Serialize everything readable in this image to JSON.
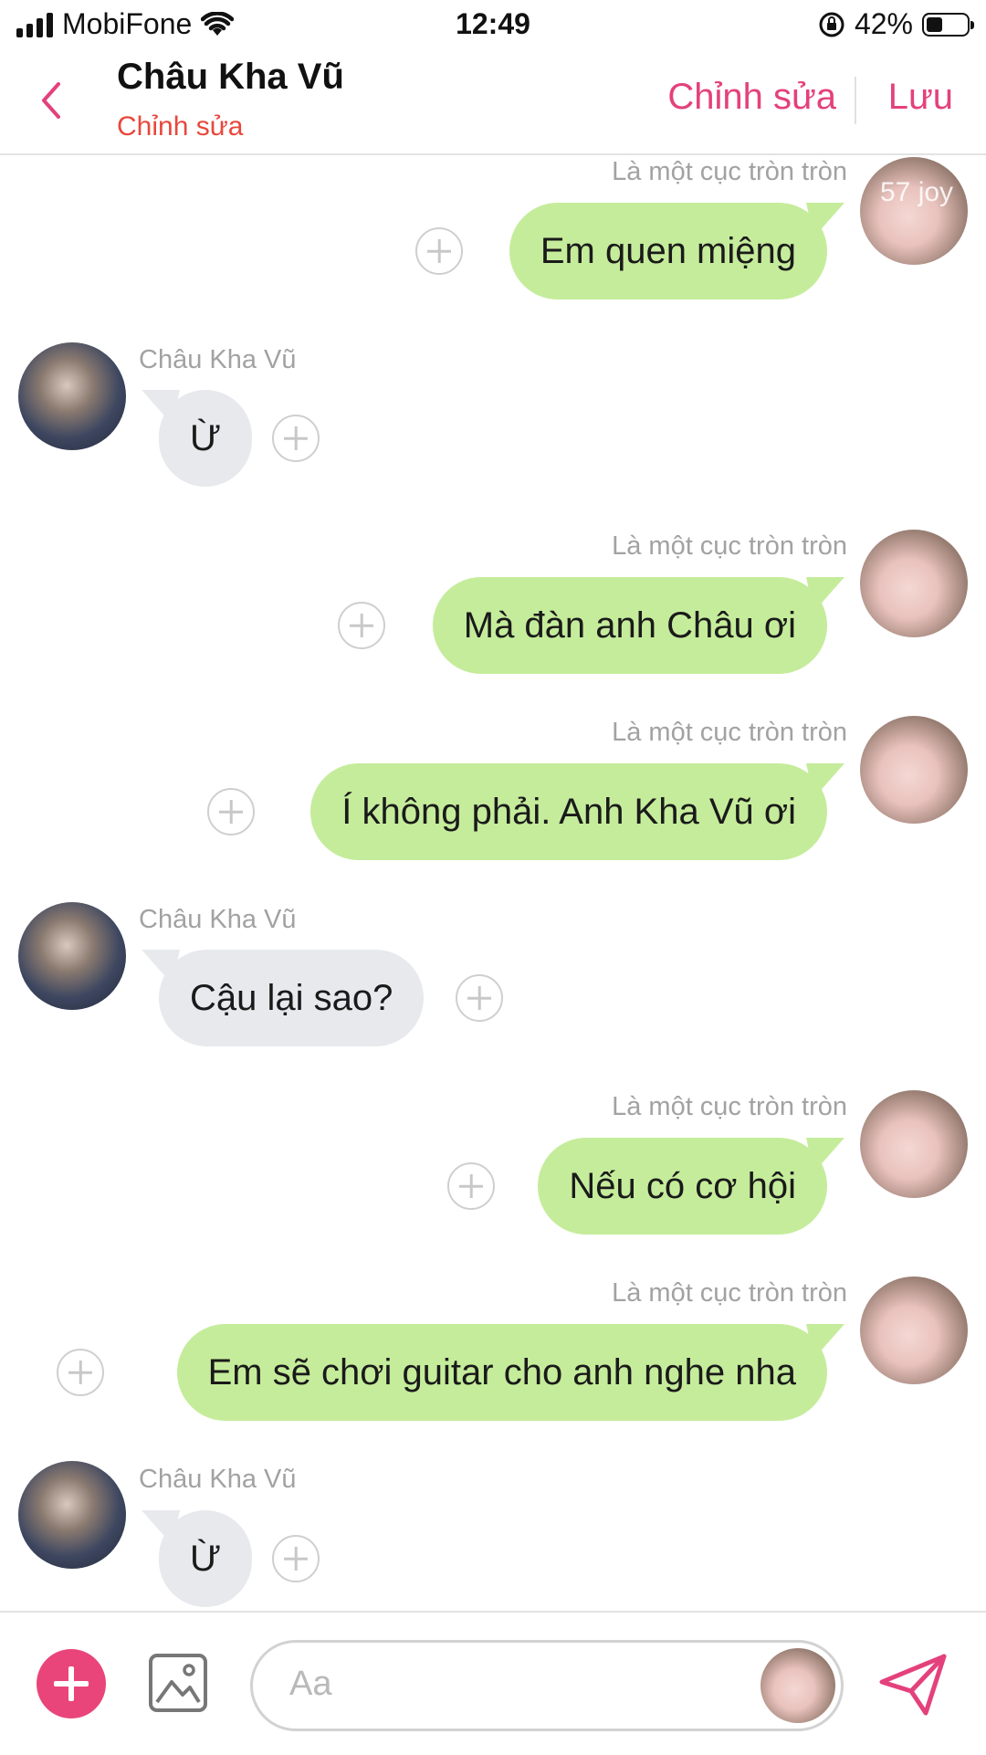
{
  "status_bar": {
    "carrier": "MobiFone",
    "time": "12:49",
    "battery_percent": "42%",
    "battery_level": 0.42
  },
  "header": {
    "title": "Châu Kha Vũ",
    "subtitle": "Chỉnh sửa",
    "edit_label": "Chỉnh sửa",
    "save_label": "Lưu"
  },
  "messages": [
    {
      "side": "right",
      "sender": "Là một cục tròn tròn",
      "text": "Em quen miệng",
      "avatar_watermark": "57 joy"
    },
    {
      "side": "left",
      "sender": "Châu Kha Vũ",
      "text": "Ừ"
    },
    {
      "side": "right",
      "sender": "Là một cục tròn tròn",
      "text": "Mà đàn anh Châu ơi"
    },
    {
      "side": "right",
      "sender": "Là một cục tròn tròn",
      "text": "Í không phải. Anh Kha Vũ ơi"
    },
    {
      "side": "left",
      "sender": "Châu Kha Vũ",
      "text": "Cậu lại sao?"
    },
    {
      "side": "right",
      "sender": "Là một cục tròn tròn",
      "text": "Nếu có cơ hội"
    },
    {
      "side": "right",
      "sender": "Là một cục tròn tròn",
      "text": "Em sẽ chơi guitar cho anh nghe nha"
    },
    {
      "side": "left",
      "sender": "Châu Kha Vũ",
      "text": "Ừ"
    }
  ],
  "composer": {
    "placeholder": "Aa"
  },
  "colors": {
    "accent": "#e4417c",
    "subtitle": "#e8483c",
    "bubble_right": "#c5ec9b",
    "bubble_left": "#e7e9ed"
  },
  "icons": [
    "back-chevron-icon",
    "wifi-icon",
    "signal-icon",
    "rotation-lock-icon",
    "battery-icon",
    "add-icon",
    "image-icon",
    "send-icon"
  ]
}
